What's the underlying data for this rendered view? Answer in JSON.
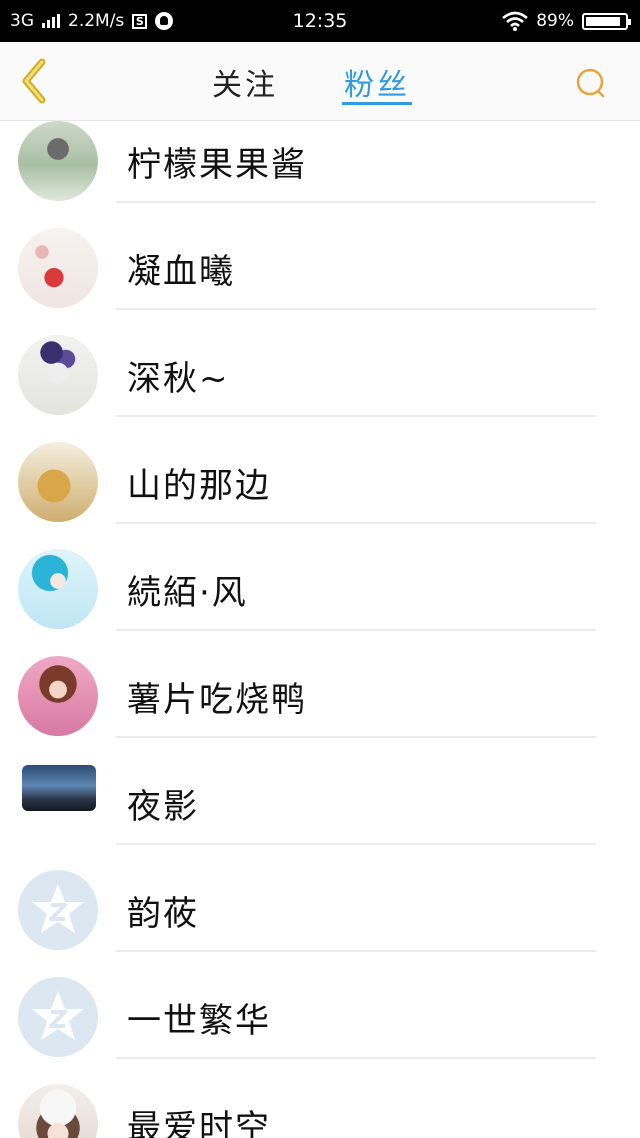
{
  "status_bar": {
    "network": "3G",
    "speed": "2.2M/s",
    "s_badge": "S",
    "time": "12:35",
    "battery": "89%",
    "battery_level": 0.89
  },
  "header": {
    "back_icon": "chevron-left-icon",
    "tab_follow": "关注",
    "tab_fans": "粉丝",
    "active_tab": "粉丝",
    "search_icon": "search-icon",
    "accent_color": "#2f9be0",
    "icon_color": "#e8a33c"
  },
  "fans": [
    {
      "name": "柠檬果果酱"
    },
    {
      "name": "凝血曦"
    },
    {
      "name": "深秋~"
    },
    {
      "name": "山的那边"
    },
    {
      "name": "続絔·风"
    },
    {
      "name": "薯片吃烧鸭"
    },
    {
      "name": "夜影"
    },
    {
      "name": "韵莜"
    },
    {
      "name": "一世繁华"
    },
    {
      "name": "最爱时空"
    }
  ]
}
